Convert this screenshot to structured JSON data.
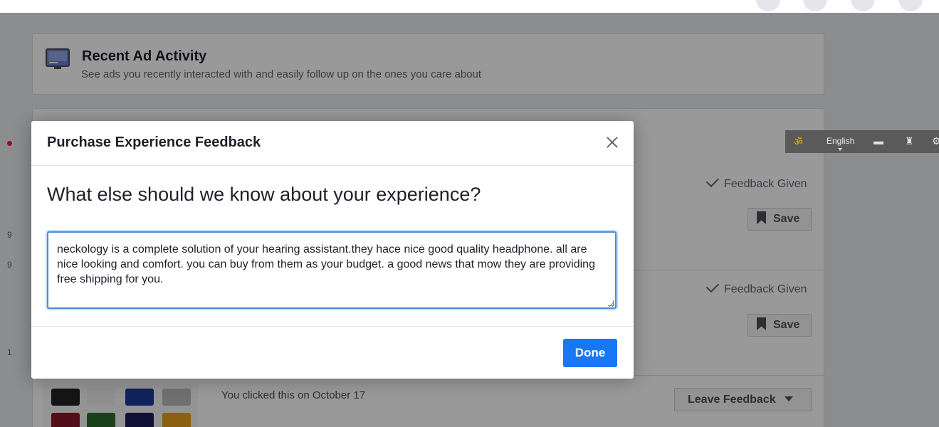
{
  "page": {
    "header": {
      "title": "Recent Ad Activity",
      "subtitle": "See ads you recently interacted with and easily follow up on the ones you care about"
    },
    "ads": [
      {
        "status": "Feedback Given",
        "save_label": "Save"
      },
      {
        "status": "Feedback Given",
        "save_label": "Save"
      }
    ],
    "third_ad": {
      "clicked_text": "You clicked this on October 17",
      "leave_feedback_label": "Leave Feedback"
    },
    "side_numbers": [
      "9",
      "9",
      "1"
    ]
  },
  "extension_bar": {
    "language": "English"
  },
  "modal": {
    "title": "Purchase Experience Feedback",
    "question": "What else should we know about your experience?",
    "textarea_value": "neckology is a complete solution of your hearing assistant.they hace nice good quality headphone. all are nice looking and comfort. you can buy from them as your budget. a good news that mow they are providing free shipping for you.",
    "done_label": "Done"
  },
  "colors": {
    "primary": "#1877f2",
    "overlay": "rgba(0,0,0,0.4)",
    "focus_border": "#4a90d9"
  }
}
